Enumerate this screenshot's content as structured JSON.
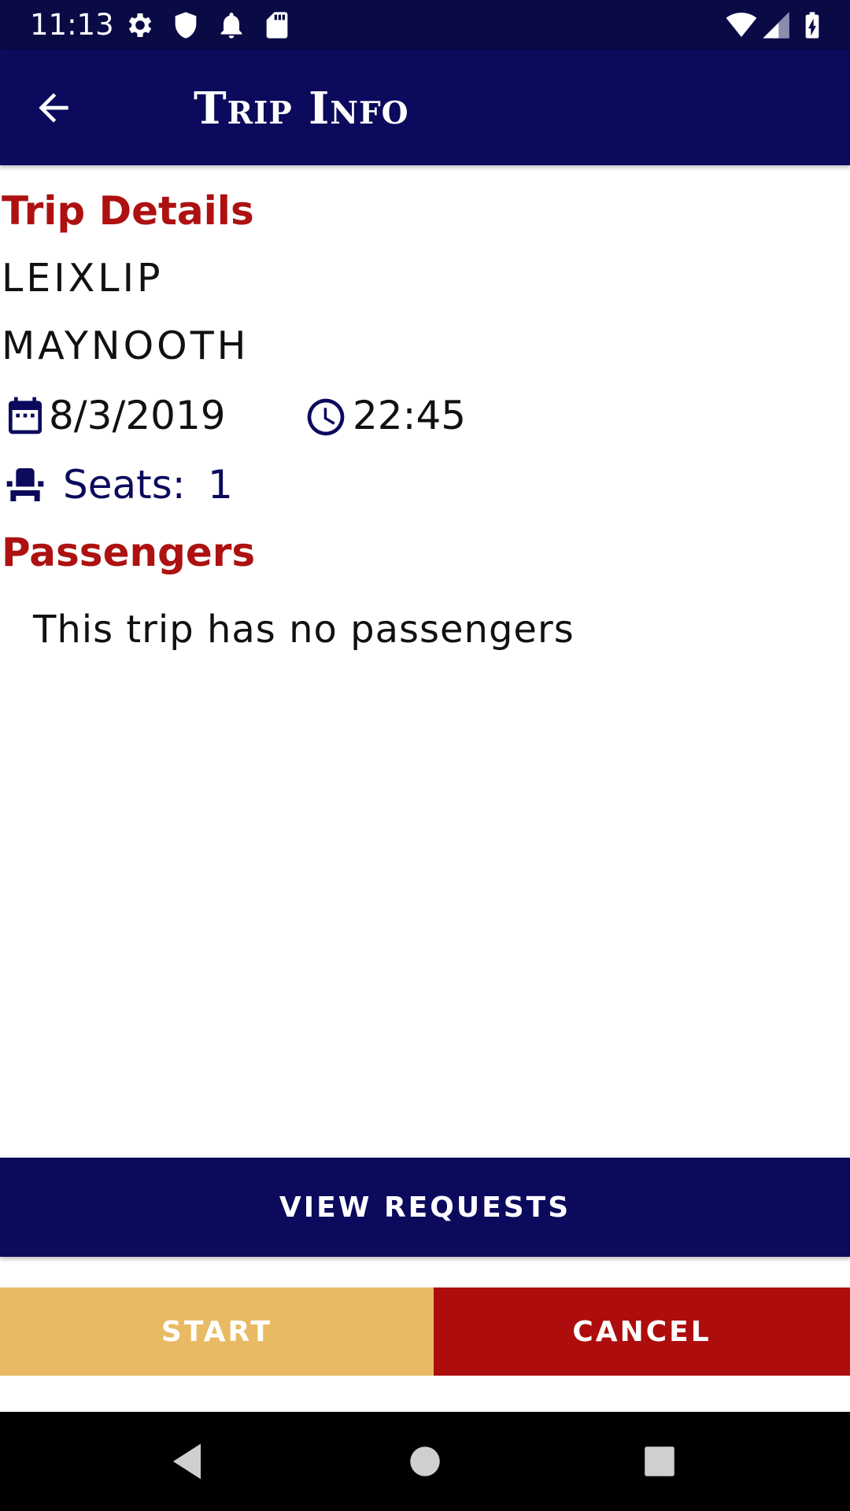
{
  "status_bar": {
    "time": "11:13",
    "left_icons": [
      "gear-icon",
      "shield-icon",
      "bell-icon",
      "sd-card-icon"
    ],
    "right_icons": [
      "wifi-icon",
      "signal-icon",
      "battery-charging-icon"
    ]
  },
  "app_bar": {
    "title": "Trip Info",
    "back_icon": "arrow-left-icon"
  },
  "trip_details": {
    "heading": "Trip Details",
    "origin": "LEIXLIP",
    "destination": "MAYNOOTH",
    "date": "8/3/2019",
    "time": "22:45",
    "seats_label": "Seats:",
    "seats_value": "1"
  },
  "passengers": {
    "heading": "Passengers",
    "empty_message": "This trip has no passengers"
  },
  "actions": {
    "view_requests_label": "VIEW REQUESTS",
    "start_label": "START",
    "cancel_label": "CANCEL"
  },
  "colors": {
    "primary_navy": "#0b0a5c",
    "status_bar": "#0a0a45",
    "heading_red": "#ad1111",
    "start_gold": "#e8ba63",
    "cancel_red": "#ad0d0d"
  },
  "nav_bar": {
    "icons": [
      "back-triangle-icon",
      "home-circle-icon",
      "recents-square-icon"
    ]
  }
}
